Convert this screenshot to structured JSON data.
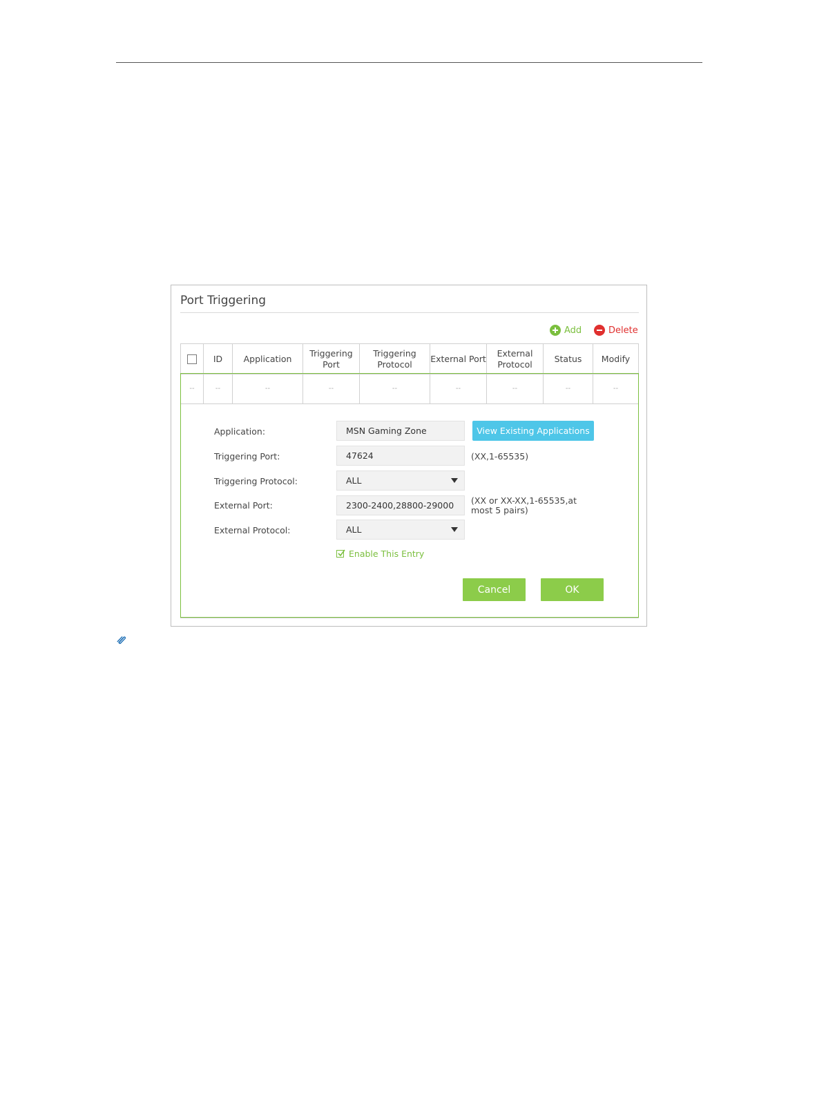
{
  "panel": {
    "title": "Port Triggering"
  },
  "toolbar": {
    "add_label": "Add",
    "delete_label": "Delete"
  },
  "table": {
    "headers": [
      "ID",
      "Application",
      "Triggering Port",
      "Triggering Protocol",
      "External Port",
      "External Protocol",
      "Status",
      "Modify"
    ],
    "row": [
      "--",
      "--",
      "--",
      "--",
      "--",
      "--",
      "--",
      "--",
      "--"
    ]
  },
  "form": {
    "application": {
      "label": "Application:",
      "value": "MSN Gaming Zone",
      "button": "View Existing Applications"
    },
    "triggering_port": {
      "label": "Triggering Port:",
      "value": "47624",
      "hint": "(XX,1-65535)"
    },
    "triggering_protocol": {
      "label": "Triggering Protocol:",
      "value": "ALL"
    },
    "external_port": {
      "label": "External Port:",
      "value": "2300-2400,28800-29000",
      "hint_line1": "(XX or XX-XX,1-65535,at",
      "hint_line2": "most 5 pairs)"
    },
    "external_protocol": {
      "label": "External Protocol:",
      "value": "ALL"
    },
    "enable_label": "Enable This Entry",
    "enable_checked": true
  },
  "actions": {
    "cancel": "Cancel",
    "ok": "OK"
  },
  "colors": {
    "accent_green": "#7bbf3e",
    "button_green": "#8ccc4a",
    "view_blue": "#4ec6e8",
    "delete_red": "#e0302f"
  },
  "icons": {
    "add": "plus-circle-icon",
    "delete": "minus-circle-icon",
    "note": "paperclip-icon"
  }
}
